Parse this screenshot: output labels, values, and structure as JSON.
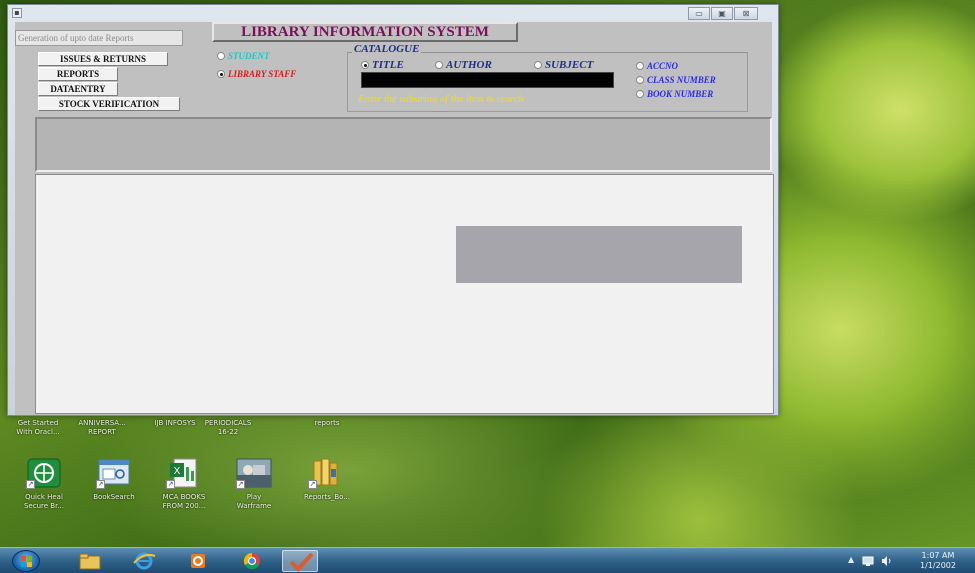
{
  "window": {
    "icon_glyph": "▪",
    "controls": {
      "minimize": "▭",
      "maximize": "▣",
      "close": "⊠"
    },
    "report_field_value": "Generation of upto date Reports",
    "title": "LIBRARY INFORMATION SYSTEM",
    "side_buttons": {
      "issues": "ISSUES & RETURNS",
      "reports": "REPORTS",
      "dataentry": "DATAENTRY",
      "stock": "STOCK VERIFICATION"
    },
    "user_type": {
      "student": "STUDENT",
      "staff": "LIBRARY STAFF",
      "selected": "LIBRARY STAFF"
    },
    "catalogue": {
      "legend": "CATALOGUE",
      "search_options": {
        "title": "TITLE",
        "author": "AUTHOR",
        "subject": "SUBJECT"
      },
      "selected": "TITLE",
      "search_value": "",
      "hint": "Enter the substring of the item to search",
      "number_options": {
        "accno": "ACCNO",
        "class": "CLASS NUMBER",
        "book": "BOOK NUMBER"
      }
    },
    "colors": {
      "title": "#7a0f5a",
      "student": "#19c9c9",
      "staff": "#d81b1b",
      "catalogue": "#1f2d86",
      "hint": "#e3d54a"
    }
  },
  "desktop": {
    "top_row": [
      {
        "label_1": "Get Started",
        "label_2": "With Oracl..."
      },
      {
        "label_1": "ANNIVERSA...",
        "label_2": "REPORT"
      },
      {
        "label_1": "IJB INFOSYS",
        "label_2": ""
      },
      {
        "label_1": "PERIODICALS",
        "label_2": "16-22"
      },
      {
        "label_1": "reports",
        "label_2": ""
      }
    ],
    "icons": [
      {
        "name": "Quick Heal",
        "label_1": "Quick Heal",
        "label_2": "Secure Br...",
        "icon": "globe-icon"
      },
      {
        "name": "BookSearch",
        "label_1": "BookSearch",
        "label_2": "",
        "icon": "window-icon"
      },
      {
        "name": "MCA BOOKS",
        "label_1": "MCA BOOKS",
        "label_2": "FROM 200...",
        "icon": "excel-icon"
      },
      {
        "name": "Play Warframe",
        "label_1": "Play",
        "label_2": "Warframe",
        "icon": "game-icon"
      },
      {
        "name": "Reports_Bo",
        "label_1": "Reports_Bo...",
        "label_2": "",
        "icon": "folder-icon"
      }
    ]
  },
  "taskbar": {
    "items": [
      "Windows Explorer",
      "Internet Explorer",
      "Outlook",
      "Google Chrome",
      "Library App"
    ],
    "tray_arrow": "▲",
    "clock_time": "1:07 AM",
    "clock_date": "1/1/2002"
  }
}
